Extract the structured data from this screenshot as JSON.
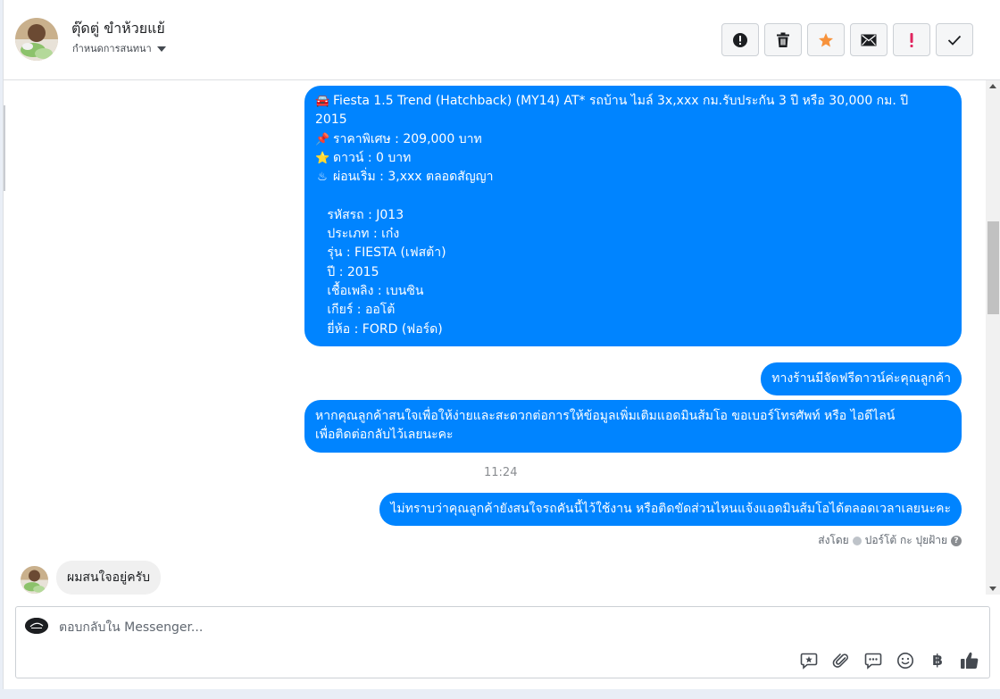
{
  "header": {
    "contact_name": "ตุ๊ดตู่ ขำห้วยแย้",
    "label_selector": "กำหนดการสนทนา",
    "actions": [
      {
        "icon": "alert-circle-icon",
        "name": "mark-spam-button"
      },
      {
        "icon": "trash-icon",
        "name": "delete-button"
      },
      {
        "icon": "star-icon",
        "name": "star-button"
      },
      {
        "icon": "envelope-icon",
        "name": "mark-unread-button"
      },
      {
        "icon": "exclamation-icon",
        "name": "follow-up-button"
      },
      {
        "icon": "check-icon",
        "name": "mark-done-button"
      }
    ]
  },
  "messages": {
    "car_details": [
      {
        "emoji": "🚘",
        "text": "Fiesta 1.5 Trend (Hatchback) (MY14) AT* รถบ้าน ไมล์ 3x,xxx กม.รับประกัน 3 ปี หรือ 30,000 กม. ปี"
      },
      {
        "emoji": "",
        "text": "2015"
      },
      {
        "emoji": "📌",
        "text": "ราคาพิเศษ : 209,000 บาท"
      },
      {
        "emoji": "⭐",
        "text": "ดาวน์ : 0 บาท"
      },
      {
        "emoji": "♨",
        "text": "ผ่อนเริ่ม : 3,xxx ตลอดสัญญา"
      },
      {
        "emoji": "",
        "text": ""
      },
      {
        "emoji": "",
        "text": "   รหัสรถ : J013"
      },
      {
        "emoji": "",
        "text": "   ประเภท : เก๋ง"
      },
      {
        "emoji": "",
        "text": "   รุ่น : FIESTA (เฟสต้า)"
      },
      {
        "emoji": "",
        "text": "   ปี : 2015"
      },
      {
        "emoji": "",
        "text": "   เชื้อเพลิง : เบนซิน"
      },
      {
        "emoji": "",
        "text": "   เกียร์ : ออโต้"
      },
      {
        "emoji": "",
        "text": "   ยี่ห้อ : FORD (ฟอร์ด)"
      }
    ],
    "free_down": "ทางร้านมีจัดฟรีดาวน์ค่ะคุณลูกค้า",
    "contact_request_line1": "หากคุณลูกค้าสนใจเพื่อให้ง่ายและสะดวกต่อการให้ข้อมูลเพิ่มเติมแอดมินส้มโอ ขอเบอร์โทรศัพท์ หรือ ไอดีไลน์",
    "contact_request_line2": "เพื่อติดต่อกลับไว้เลยนะคะ",
    "timestamp": "11:24",
    "followup": "ไม่ทราบว่าคุณลูกค้ายังสนใจรถคันนี้ไว้ใช้งาน หรือติดขัดส่วนไหนแจ้งแอดมินส้มโอได้ตลอดเวลาเลยนะคะ",
    "sent_by_prefix": "ส่งโดย",
    "sent_by_name": "ปอร์โต้ กะ ปุยฝ้าย",
    "incoming": "ผมสนใจอยู่ครับ"
  },
  "composer": {
    "placeholder": "ตอบกลับใน Messenger...",
    "tools": [
      "saved-reply-icon",
      "attachment-icon",
      "chat-bubble-icon",
      "emoji-icon",
      "baht-icon",
      "like-icon"
    ],
    "baht_symbol": "฿"
  },
  "colors": {
    "outgoing_bubble": "#0084ff",
    "incoming_bubble": "#f0f0f0",
    "star": "#f7923b",
    "follow_up": "#e0245e"
  }
}
